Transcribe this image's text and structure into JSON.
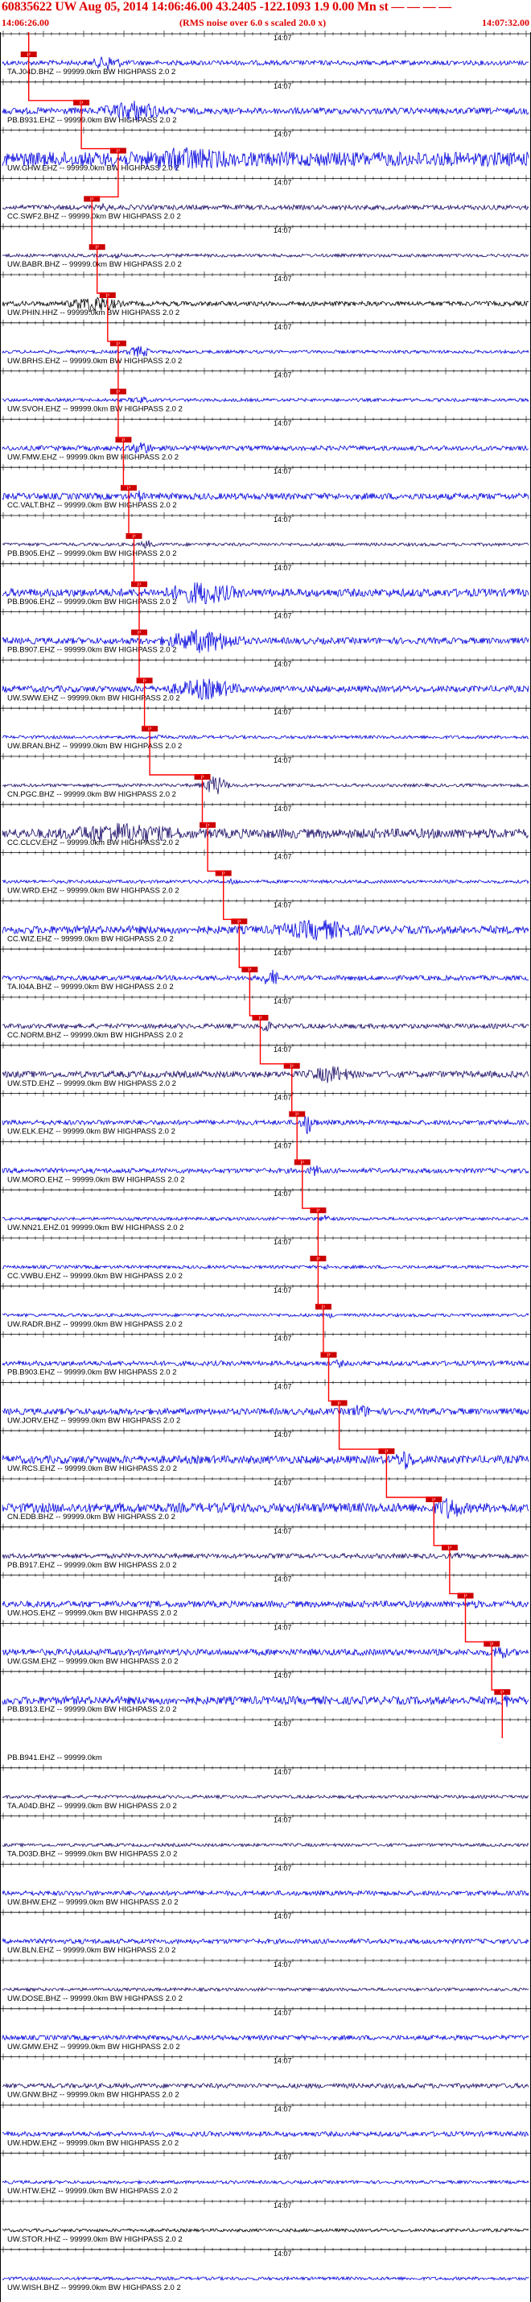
{
  "header": {
    "title": "60835622 UW Aug 05, 2014 14:06:46.00   43.2405 -122.1093  1.9 0.00 Mn st — — — —",
    "note": "(RMS noise over 6.0 s scaled 20.0 x)",
    "start_time": "14:06:26.00",
    "end_time": "14:07:32.00"
  },
  "time_tick_label": "14:07",
  "pick_label": "P",
  "colors": {
    "accent": "#e00000",
    "trace_blue": "#0000dd",
    "trace_navy": "#1a0a66",
    "trace_black": "#000000",
    "pick_red": "#ff0000",
    "pick_box": "#cc0000"
  },
  "traces": [
    {
      "label": "TA.J04D.BHZ -- 99999.0km BW  HIGHPASS  2.0  2",
      "color": "blue",
      "amp": 3,
      "pick": 0.05,
      "burst": [
        0.15,
        0.25,
        10
      ]
    },
    {
      "label": "PB.B931.EHZ -- 99999.0km BW  HIGHPASS  2.0  2",
      "color": "blue",
      "amp": 4,
      "pick": 0.15,
      "burst": [
        0.15,
        0.35,
        14
      ]
    },
    {
      "label": "UW.GHW.EHZ -- 99999.0km BW  HIGHPASS  2.0  2",
      "color": "blue",
      "amp": 9,
      "pick": 0.22,
      "burst": [
        0.15,
        0.55,
        16
      ]
    },
    {
      "label": "CC.SWF2.BHZ -- 99999.0km BW  HIGHPASS  2.0  2",
      "color": "navy",
      "amp": 3,
      "pick": 0.17,
      "burst": [
        0.17,
        0.22,
        6
      ]
    },
    {
      "label": "UW.BABR.BHZ -- 99999.0km BW  HIGHPASS  2.0  2",
      "color": "navy",
      "amp": 2,
      "pick": 0.18,
      "burst": [
        0.19,
        0.25,
        4
      ]
    },
    {
      "label": "UW.PHIN.HHZ -- 99999.0km BW  HIGHPASS  2.0  2",
      "color": "black",
      "amp": 3,
      "pick": 0.2,
      "burst": [
        0.1,
        0.25,
        12
      ]
    },
    {
      "label": "UW.BRHS.EHZ -- 99999.0km BW  HIGHPASS  2.0  2",
      "color": "blue",
      "amp": 2,
      "pick": 0.22,
      "burst": [
        0.22,
        0.3,
        8
      ]
    },
    {
      "label": "UW.SVOH.EHZ -- 99999.0km BW  HIGHPASS  2.0  2",
      "color": "blue",
      "amp": 2,
      "pick": 0.22,
      "burst": [
        0.22,
        0.3,
        5
      ]
    },
    {
      "label": "UW.FMW.EHZ -- 99999.0km BW  HIGHPASS  2.0  2",
      "color": "blue",
      "amp": 3,
      "pick": 0.23,
      "burst": [
        0.23,
        0.3,
        10
      ]
    },
    {
      "label": "CC.VALT.BHZ -- 99999.0km BW  HIGHPASS  2.0  2",
      "color": "blue",
      "amp": 4,
      "pick": 0.24,
      "burst": [
        0.24,
        0.28,
        8
      ]
    },
    {
      "label": "PB.B905.EHZ -- 99999.0km BW  HIGHPASS  2.0  2",
      "color": "navy",
      "amp": 2,
      "pick": 0.25,
      "burst": [
        0.25,
        0.3,
        6
      ]
    },
    {
      "label": "PB.B906.EHZ -- 99999.0km BW  HIGHPASS  2.0  2",
      "color": "blue",
      "amp": 5,
      "pick": 0.26,
      "burst": [
        0.26,
        0.5,
        16
      ]
    },
    {
      "label": "PB.B907.EHZ -- 99999.0km BW  HIGHPASS  2.0  2",
      "color": "blue",
      "amp": 4,
      "pick": 0.26,
      "burst": [
        0.26,
        0.5,
        16
      ]
    },
    {
      "label": "UW.SWW.EHZ -- 99999.0km BW  HIGHPASS  2.0  2",
      "color": "blue",
      "amp": 4,
      "pick": 0.27,
      "burst": [
        0.27,
        0.5,
        14
      ]
    },
    {
      "label": "UW.BRAN.BHZ -- 99999.0km BW  HIGHPASS  2.0  2",
      "color": "blue",
      "amp": 2,
      "pick": 0.28,
      "burst": [
        0.28,
        0.32,
        5
      ]
    },
    {
      "label": "CN.PGC.BHZ -- 99999.0km BW  HIGHPASS  2.0  2",
      "color": "navy",
      "amp": 2,
      "pick": 0.38,
      "burst": [
        0.37,
        0.44,
        14
      ]
    },
    {
      "label": "CC.CLCV.EHZ -- 99999.0km BW  HIGHPASS  2.0  2",
      "color": "navy",
      "amp": 6,
      "pick": 0.39,
      "burst": [
        0.0,
        0.45,
        14
      ]
    },
    {
      "label": "UW.WRD.EHZ -- 99999.0km BW  HIGHPASS  2.0  2",
      "color": "blue",
      "amp": 2,
      "pick": 0.42,
      "burst": [
        0.42,
        0.46,
        5
      ]
    },
    {
      "label": "CC.WIZ.EHZ -- 99999.0km BW  HIGHPASS  2.0  2",
      "color": "blue",
      "amp": 5,
      "pick": 0.45,
      "burst": [
        0.45,
        0.75,
        14
      ]
    },
    {
      "label": "TA.I04A.BHZ -- 99999.0km BW  HIGHPASS  2.0  2",
      "color": "blue",
      "amp": 3,
      "pick": 0.47,
      "burst": [
        0.48,
        0.54,
        12
      ]
    },
    {
      "label": "CC.NORM.BHZ -- 99999.0km BW  HIGHPASS  2.0  2",
      "color": "navy",
      "amp": 3,
      "pick": 0.49,
      "burst": [
        0.48,
        0.52,
        10
      ]
    },
    {
      "label": "UW.STD.EHZ -- 99999.0km BW  HIGHPASS  2.0  2",
      "color": "navy",
      "amp": 4,
      "pick": 0.55,
      "burst": [
        0.55,
        0.7,
        12
      ]
    },
    {
      "label": "UW.ELK.EHZ -- 99999.0km BW  HIGHPASS  2.0  2",
      "color": "blue",
      "amp": 3,
      "pick": 0.56,
      "burst": [
        0.56,
        0.6,
        16
      ]
    },
    {
      "label": "UW.MORO.EHZ -- 99999.0km BW  HIGHPASS  2.0  2",
      "color": "blue",
      "amp": 3,
      "pick": 0.57,
      "burst": [
        0.57,
        0.62,
        8
      ]
    },
    {
      "label": "UW.NN21.EHZ.01 99999.0km BW  HIGHPASS  2.0  2",
      "color": "blue",
      "amp": 2,
      "pick": 0.6,
      "burst": [
        0.6,
        0.63,
        8
      ]
    },
    {
      "label": "CC.VWBU.EHZ -- 99999.0km BW  HIGHPASS  2.0  2",
      "color": "blue",
      "amp": 2,
      "pick": 0.6,
      "burst": [
        0.6,
        0.63,
        4
      ]
    },
    {
      "label": "UW.RADR.BHZ -- 99999.0km BW  HIGHPASS  2.0  2",
      "color": "blue",
      "amp": 2,
      "pick": 0.61,
      "burst": [
        0.61,
        0.64,
        4
      ]
    },
    {
      "label": "PB.B903.EHZ -- 99999.0km BW  HIGHPASS  2.0  2",
      "color": "blue",
      "amp": 3,
      "pick": 0.62,
      "burst": [
        0.62,
        0.66,
        6
      ]
    },
    {
      "label": "UW.JORV.EHZ -- 99999.0km BW  HIGHPASS  2.0  2",
      "color": "blue",
      "amp": 4,
      "pick": 0.64,
      "burst": [
        0.64,
        0.72,
        10
      ]
    },
    {
      "label": "UW.RCS.EHZ -- 99999.0km BW  HIGHPASS  2.0  2",
      "color": "blue",
      "amp": 5,
      "pick": 0.73,
      "burst": [
        0.73,
        0.8,
        14
      ]
    },
    {
      "label": "CN.EDB.BHZ -- 99999.0km BW  HIGHPASS  2.0  2",
      "color": "blue",
      "amp": 6,
      "pick": 0.82,
      "burst": [
        0.8,
        0.9,
        16
      ]
    },
    {
      "label": "PB.B917.EHZ -- 99999.0km BW  HIGHPASS  2.0  2",
      "color": "navy",
      "amp": 3,
      "pick": 0.85,
      "burst": [
        0.85,
        0.88,
        4
      ]
    },
    {
      "label": "UW.HOS.EHZ -- 99999.0km BW  HIGHPASS  2.0  2",
      "color": "blue",
      "amp": 4,
      "pick": 0.88,
      "burst": [
        0.88,
        0.92,
        6
      ]
    },
    {
      "label": "UW.GSM.EHZ -- 99999.0km BW  HIGHPASS  2.0  2",
      "color": "blue",
      "amp": 4,
      "pick": 0.93,
      "burst": [
        0.92,
        0.97,
        12
      ]
    },
    {
      "label": "PB.B913.EHZ -- 99999.0km BW  HIGHPASS  2.0  2",
      "color": "blue",
      "amp": 5,
      "pick": 0.95,
      "burst": [
        0.93,
        0.98,
        10
      ]
    },
    {
      "label": "PB.B941.EHZ -- 99999.0km",
      "color": "navy",
      "amp": 0,
      "pick": null,
      "burst": null
    },
    {
      "label": "TA.A04D.BHZ -- 99999.0km BW  HIGHPASS  2.0  2",
      "color": "navy",
      "amp": 2,
      "pick": null,
      "burst": null
    },
    {
      "label": "TA.D03D.BHZ -- 99999.0km BW  HIGHPASS  2.0  2",
      "color": "navy",
      "amp": 2,
      "pick": null,
      "burst": null
    },
    {
      "label": "UW.BHW.EHZ -- 99999.0km BW  HIGHPASS  2.0  2",
      "color": "blue",
      "amp": 3,
      "pick": null,
      "burst": null
    },
    {
      "label": "UW.BLN.EHZ -- 99999.0km BW  HIGHPASS  2.0  2",
      "color": "blue",
      "amp": 3,
      "pick": null,
      "burst": null
    },
    {
      "label": "UW.DOSE.BHZ -- 99999.0km BW  HIGHPASS  2.0  2",
      "color": "navy",
      "amp": 2,
      "pick": null,
      "burst": null
    },
    {
      "label": "UW.GMW.EHZ -- 99999.0km BW  HIGHPASS  2.0  2",
      "color": "blue",
      "amp": 3,
      "pick": null,
      "burst": null
    },
    {
      "label": "UW.GNW.BHZ -- 99999.0km BW  HIGHPASS  2.0  2",
      "color": "navy",
      "amp": 3,
      "pick": null,
      "burst": null
    },
    {
      "label": "UW.HDW.EHZ -- 99999.0km BW  HIGHPASS  2.0  2",
      "color": "blue",
      "amp": 3,
      "pick": null,
      "burst": null
    },
    {
      "label": "UW.HTW.EHZ -- 99999.0km BW  HIGHPASS  2.0  2",
      "color": "blue",
      "amp": 2,
      "pick": null,
      "burst": null
    },
    {
      "label": "UW.STOR.HHZ -- 99999.0km BW  HIGHPASS  2.0  2",
      "color": "black",
      "amp": 2,
      "pick": null,
      "burst": null
    },
    {
      "label": "UW.WISH.BHZ -- 99999.0km BW  HIGHPASS  2.0  2",
      "color": "blue",
      "amp": 2,
      "pick": null,
      "burst": null
    }
  ]
}
